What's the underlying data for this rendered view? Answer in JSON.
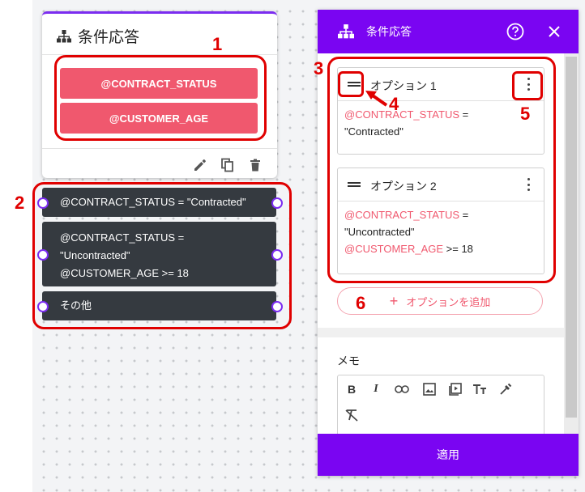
{
  "node": {
    "title": "条件応答",
    "variables": [
      "@CONTRACT_STATUS",
      "@CUSTOMER_AGE"
    ],
    "actions": [
      "edit-icon",
      "copy-icon",
      "delete-icon"
    ]
  },
  "outputs": [
    {
      "line1": "@CONTRACT_STATUS = \"Contracted\""
    },
    {
      "line1": "@CONTRACT_STATUS =",
      "line2": "\"Uncontracted\"",
      "line3": "@CUSTOMER_AGE >= 18"
    },
    {
      "line1": "その他"
    }
  ],
  "panel": {
    "title": "条件応答",
    "help_icon": "help-icon",
    "close_icon": "close-icon",
    "options": [
      {
        "label": "オプション 1",
        "cond1_var": "@CONTRACT_STATUS",
        "cond1_rest": " =",
        "cond1_value": "\"Contracted\""
      },
      {
        "label": "オプション 2",
        "cond1_var": "@CONTRACT_STATUS",
        "cond1_rest": " =",
        "cond1_value": "\"Uncontracted\"",
        "cond2_var": "@CUSTOMER_AGE",
        "cond2_rest": " >= 18"
      }
    ],
    "add_option": "オプションを追加",
    "memo_label": "メモ",
    "apply": "適用"
  },
  "annotations": [
    "1",
    "2",
    "3",
    "4",
    "5",
    "6"
  ],
  "colors": {
    "accent": "#7a05f2",
    "variable": "#f0586e",
    "annotation": "#e00000",
    "output_bg": "#353a40"
  }
}
